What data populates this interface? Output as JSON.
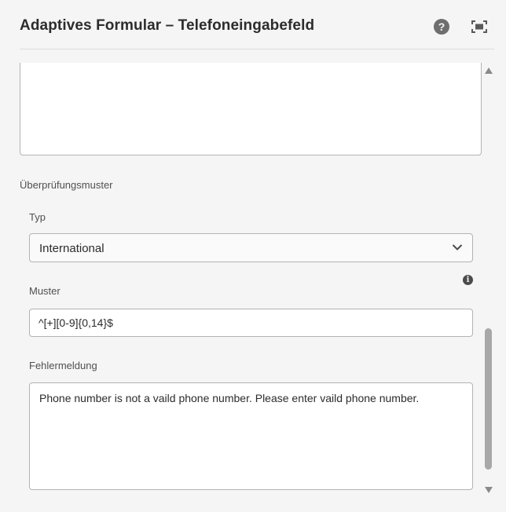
{
  "dialog": {
    "title": "Adaptives Formular – Telefoneingabefeld",
    "help_icon": "help-icon",
    "fullscreen_icon": "fullscreen-icon"
  },
  "form": {
    "section_label": "Überprüfungsmuster",
    "type": {
      "label": "Typ",
      "selected": "International",
      "icon": "chevron-down-icon"
    },
    "pattern": {
      "label": "Muster",
      "value": "^[+][0-9]{0,14}$",
      "info_icon": "info-icon"
    },
    "error_message": {
      "label": "Fehlermeldung",
      "value": "Phone number is not a vaild phone number. Please enter vaild phone number."
    }
  },
  "colors": {
    "background": "#f5f5f5",
    "border": "#b3b3b3",
    "text": "#323232",
    "scroll_thumb": "#a8a8a8"
  }
}
